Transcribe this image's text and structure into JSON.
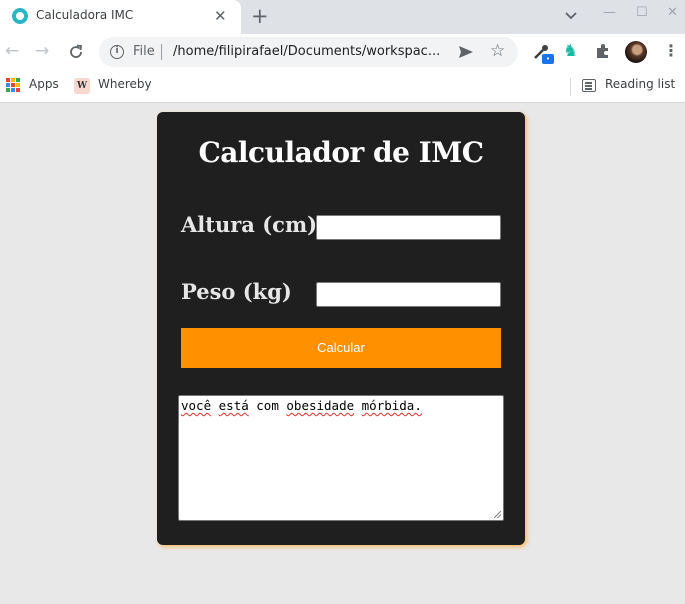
{
  "tab": {
    "title": "Calculadora IMC",
    "favicon": "calculator-favicon",
    "accent": "#29b6c4"
  },
  "toolbar": {
    "scheme_label": "File",
    "url": "/home/filipirafael/Documents/workspac..."
  },
  "bookmarks": {
    "apps_label": "Apps",
    "whereby_label": "Whereby",
    "whereby_icon_letter": "W",
    "reading_list_label": "Reading list"
  },
  "page": {
    "title": "Calculador de IMC",
    "height_label": "Altura (cm)",
    "height_value": "",
    "weight_label": "Peso (kg)",
    "weight_value": "",
    "button_label": "Calcular",
    "result_words": [
      "você",
      "está",
      "com",
      "obesidade",
      "mórbida."
    ],
    "colors": {
      "card": "#1f1f1f",
      "button": "#ff9100",
      "background": "#e8e8e8"
    }
  }
}
